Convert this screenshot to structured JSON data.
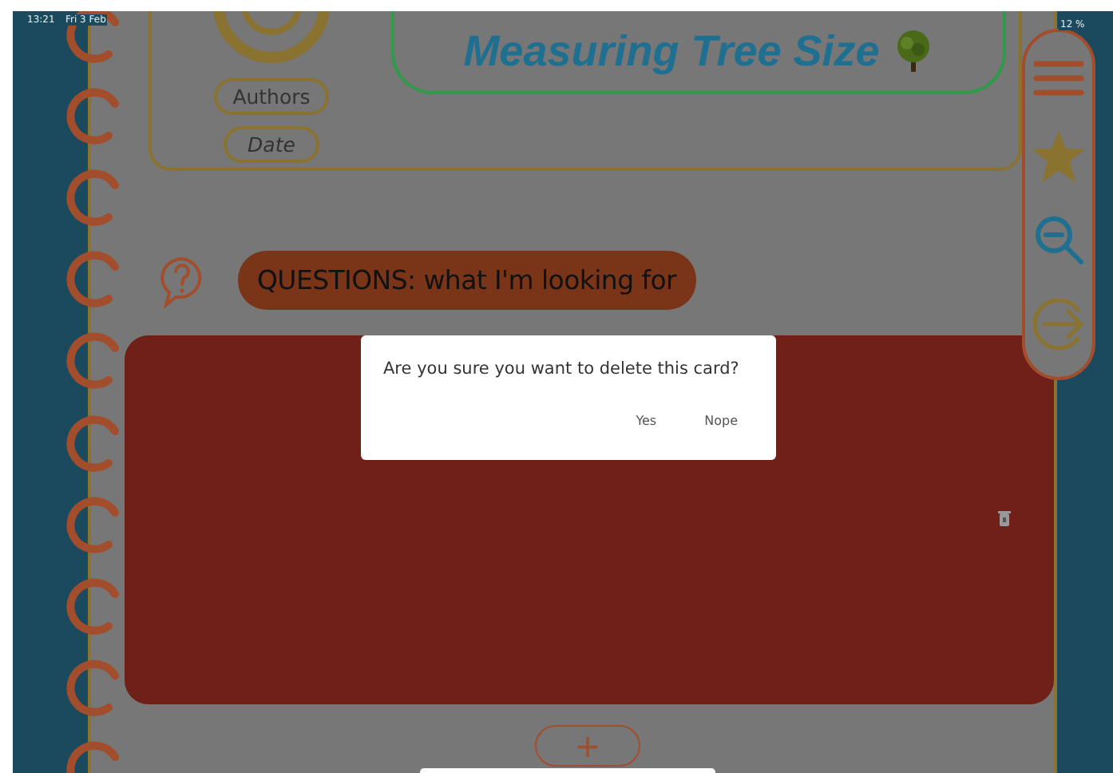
{
  "status_bar": {
    "time": "13:21",
    "date": "Fri 3 Feb",
    "battery": "12 %"
  },
  "header": {
    "authors": "Authors",
    "date": "Date",
    "title": "Measuring Tree Size"
  },
  "section": {
    "label": "QUESTIONS: what I'm looking for"
  },
  "add_button": "+",
  "dialog": {
    "message": "Are you sure you want to delete this card?",
    "buttons": [
      "Yes",
      "Nope"
    ]
  }
}
